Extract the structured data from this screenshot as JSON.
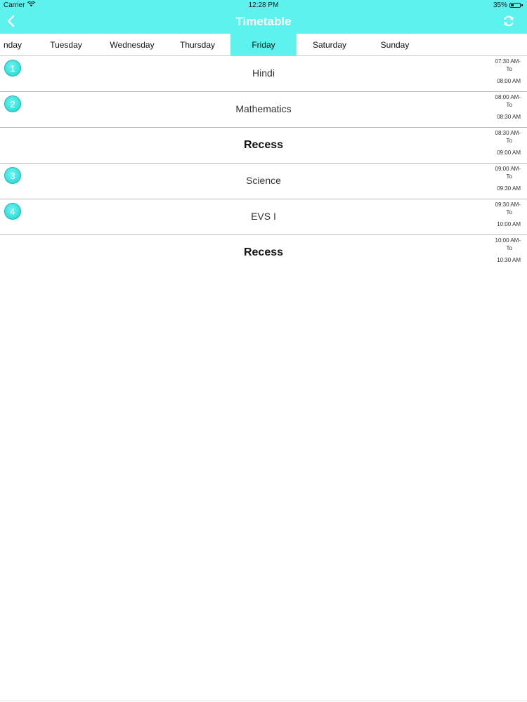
{
  "status_bar": {
    "carrier": "Carrier",
    "time": "12:28 PM",
    "battery": "35%",
    "battery_level": 0.35,
    "wifi_icon": "wifi-icon"
  },
  "header": {
    "title": "Timetable",
    "back_icon": "chevron-left-icon",
    "refresh_icon": "refresh-icon",
    "color": "#5ef2ee"
  },
  "day_tabs": [
    {
      "label": "Monday",
      "visible_label": "nday",
      "active": false
    },
    {
      "label": "Tuesday",
      "visible_label": "Tuesday",
      "active": false
    },
    {
      "label": "Wednesday",
      "visible_label": "Wednesday",
      "active": false
    },
    {
      "label": "Thursday",
      "visible_label": "Thursday",
      "active": false
    },
    {
      "label": "Friday",
      "visible_label": "Friday",
      "active": true
    },
    {
      "label": "Saturday",
      "visible_label": "Saturday",
      "active": false
    },
    {
      "label": "Sunday",
      "visible_label": "Sunday",
      "active": false
    }
  ],
  "periods": [
    {
      "number": "1",
      "subject": "Hindi",
      "start": "07:30 AM-",
      "to": "To",
      "end": "08:00 AM",
      "recess": false
    },
    {
      "number": "2",
      "subject": "Mathematics",
      "start": "08:00 AM-",
      "to": "To",
      "end": "08:30 AM",
      "recess": false
    },
    {
      "number": "",
      "subject": "Recess",
      "start": "08:30 AM-",
      "to": "To",
      "end": "09:00 AM",
      "recess": true
    },
    {
      "number": "3",
      "subject": "Science",
      "start": "09:00 AM-",
      "to": "To",
      "end": "09:30 AM",
      "recess": false
    },
    {
      "number": "4",
      "subject": "EVS I",
      "start": "09:30 AM-",
      "to": "To",
      "end": "10:00 AM",
      "recess": false
    },
    {
      "number": "",
      "subject": "Recess",
      "start": "10:00 AM-",
      "to": "To",
      "end": "10:30 AM",
      "recess": true
    }
  ]
}
